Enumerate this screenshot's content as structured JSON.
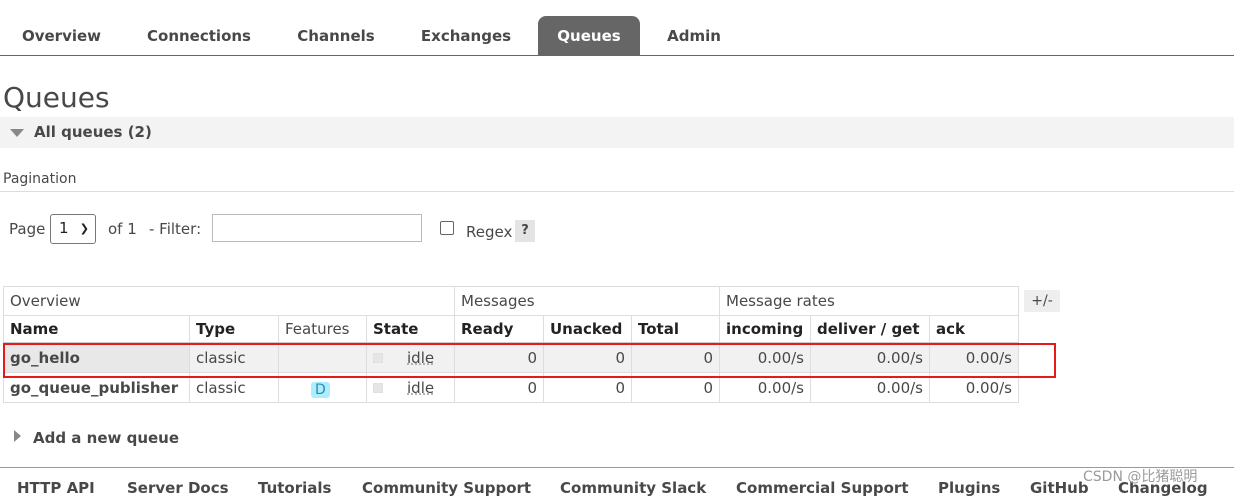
{
  "nav": {
    "tabs": [
      {
        "label": "Overview"
      },
      {
        "label": "Connections"
      },
      {
        "label": "Channels"
      },
      {
        "label": "Exchanges"
      },
      {
        "label": "Queues",
        "active": true
      },
      {
        "label": "Admin"
      }
    ]
  },
  "page": {
    "title": "Queues",
    "section_label": "All queues (2)"
  },
  "pagination": {
    "label": "Pagination",
    "page_label": "Page",
    "page_value": "1",
    "of_label": "of 1",
    "filter_label": "- Filter:",
    "filter_value": "",
    "regex_label": "Regex",
    "regex_checked": false,
    "help_label": "?"
  },
  "table": {
    "groups": [
      "Overview",
      "Messages",
      "Message rates"
    ],
    "columns": [
      "Name",
      "Type",
      "Features",
      "State",
      "Ready",
      "Unacked",
      "Total",
      "incoming",
      "deliver / get",
      "ack"
    ],
    "plusminus": "+/-",
    "rows": [
      {
        "name": "go_hello",
        "type": "classic",
        "features": "",
        "state": "idle",
        "ready": "0",
        "unacked": "0",
        "total": "0",
        "incoming": "0.00/s",
        "deliver_get": "0.00/s",
        "ack": "0.00/s"
      },
      {
        "name": "go_queue_publisher",
        "type": "classic",
        "features": "D",
        "state": "idle",
        "ready": "0",
        "unacked": "0",
        "total": "0",
        "incoming": "0.00/s",
        "deliver_get": "0.00/s",
        "ack": "0.00/s"
      }
    ]
  },
  "add_queue": {
    "label": "Add a new queue"
  },
  "footer": {
    "links": [
      "HTTP API",
      "Server Docs",
      "Tutorials",
      "Community Support",
      "Community Slack",
      "Commercial Support",
      "Plugins",
      "GitHub",
      "Changelog"
    ]
  },
  "watermark": "CSDN @比猪聪明",
  "colors": {
    "active_tab_bg": "#666666",
    "highlight_border": "#e51b1b",
    "badge_bg": "#aaeeff"
  }
}
